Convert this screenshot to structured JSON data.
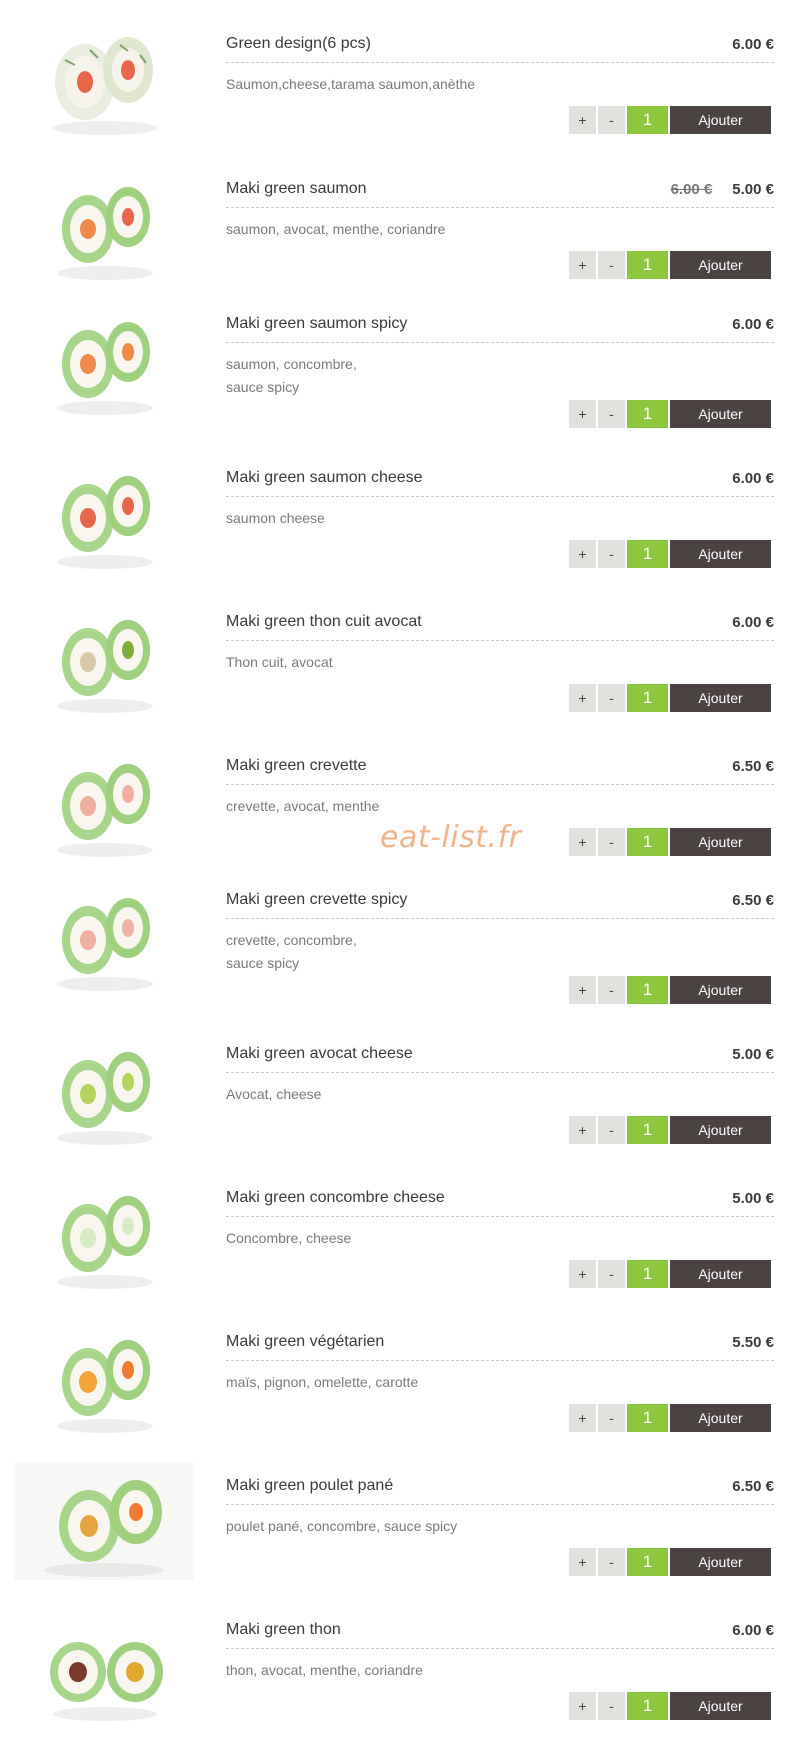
{
  "colors": {
    "qty_accent": "#8dc63f",
    "add_button": "#4b4242",
    "qty_button": "#e2e0dd",
    "watermark": "#f0b48c",
    "roll_wrap": "#a7d58a"
  },
  "watermark": "eat-list.fr",
  "items": [
    {
      "title": "Green design(6 pcs)",
      "old_price": "",
      "price": "6.00 €",
      "desc1": "Saumon,cheese,tarama saumon,anèthe",
      "desc2": "",
      "plus": "+",
      "minus": "-",
      "qty": "1",
      "add": "Ajouter",
      "image": "sushi-roll-image"
    },
    {
      "title": "Maki green saumon",
      "old_price": "6.00 €",
      "price": "5.00 €",
      "desc1": "saumon, avocat, menthe, coriandre",
      "desc2": "",
      "plus": "+",
      "minus": "-",
      "qty": "1",
      "add": "Ajouter",
      "image": "sushi-roll-image"
    },
    {
      "title": "Maki green saumon spicy",
      "old_price": "",
      "price": "6.00 €",
      "desc1": "saumon, concombre,",
      "desc2": "sauce spicy",
      "plus": "+",
      "minus": "-",
      "qty": "1",
      "add": "Ajouter",
      "image": "sushi-roll-image"
    },
    {
      "title": "Maki green saumon cheese",
      "old_price": "",
      "price": "6.00 €",
      "desc1": "saumon cheese",
      "desc2": "",
      "plus": "+",
      "minus": "-",
      "qty": "1",
      "add": "Ajouter",
      "image": "sushi-roll-image"
    },
    {
      "title": "Maki green thon cuit avocat",
      "old_price": "",
      "price": "6.00 €",
      "desc1": "Thon cuit, avocat",
      "desc2": "",
      "plus": "+",
      "minus": "-",
      "qty": "1",
      "add": "Ajouter",
      "image": "sushi-roll-image"
    },
    {
      "title": "Maki green crevette",
      "old_price": "",
      "price": "6.50 €",
      "desc1": "crevette, avocat, menthe",
      "desc2": "",
      "plus": "+",
      "minus": "-",
      "qty": "1",
      "add": "Ajouter",
      "image": "sushi-roll-image"
    },
    {
      "title": "Maki green crevette spicy",
      "old_price": "",
      "price": "6.50 €",
      "desc1": "crevette, concombre,",
      "desc2": "sauce spicy",
      "plus": "+",
      "minus": "-",
      "qty": "1",
      "add": "Ajouter",
      "image": "sushi-roll-image"
    },
    {
      "title": "Maki green avocat cheese",
      "old_price": "",
      "price": "5.00 €",
      "desc1": "Avocat, cheese",
      "desc2": "",
      "plus": "+",
      "minus": "-",
      "qty": "1",
      "add": "Ajouter",
      "image": "sushi-roll-image"
    },
    {
      "title": "Maki green concombre cheese",
      "old_price": "",
      "price": "5.00 €",
      "desc1": "Concombre, cheese",
      "desc2": "",
      "plus": "+",
      "minus": "-",
      "qty": "1",
      "add": "Ajouter",
      "image": "sushi-roll-image"
    },
    {
      "title": "Maki green végétarien",
      "old_price": "",
      "price": "5.50 €",
      "desc1": "maïs, pignon, omelette, carotte",
      "desc2": "",
      "plus": "+",
      "minus": "-",
      "qty": "1",
      "add": "Ajouter",
      "image": "sushi-roll-image"
    },
    {
      "title": "Maki green poulet pané",
      "old_price": "",
      "price": "6.50 €",
      "desc1": "poulet pané, concombre, sauce spicy",
      "desc2": "",
      "plus": "+",
      "minus": "-",
      "qty": "1",
      "add": "Ajouter",
      "image": "sushi-roll-image"
    },
    {
      "title": "Maki green thon",
      "old_price": "",
      "price": "6.00 €",
      "desc1": "thon, avocat, menthe, coriandre",
      "desc2": "",
      "plus": "+",
      "minus": "-",
      "qty": "1",
      "add": "Ajouter",
      "image": "sushi-roll-image"
    }
  ]
}
